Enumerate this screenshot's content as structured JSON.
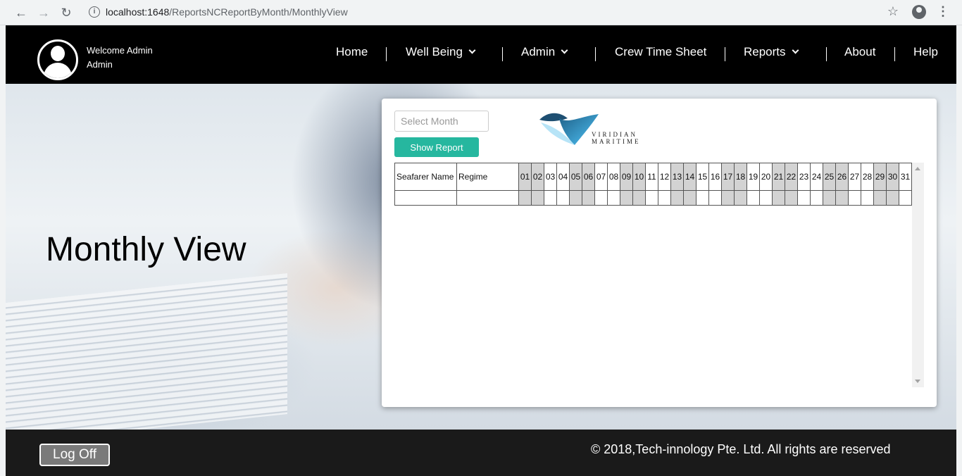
{
  "browser": {
    "url_host": "localhost:1648",
    "url_path": "/ReportsNCReportByMonth/MonthlyView",
    "star_icon": "star-icon",
    "account_icon": "account-icon"
  },
  "header": {
    "welcome_line1": "Welcome Admin",
    "welcome_line2": "Admin",
    "nav": {
      "home": "Home",
      "well_being": "Well Being",
      "admin": "Admin",
      "crew_time_sheet": "Crew Time Sheet",
      "reports": "Reports",
      "about": "About",
      "help": "Help"
    }
  },
  "hero": {
    "title": "Monthly View"
  },
  "panel": {
    "month_placeholder": "Select Month",
    "show_report_label": "Show Report",
    "logo_line1": "VIRIDIAN",
    "logo_line2": "MARITIME",
    "table": {
      "col_name": "Seafarer Name",
      "col_regime": "Regime",
      "days": [
        "01",
        "02",
        "03",
        "04",
        "05",
        "06",
        "07",
        "08",
        "09",
        "10",
        "11",
        "12",
        "13",
        "14",
        "15",
        "16",
        "17",
        "18",
        "19",
        "20",
        "21",
        "22",
        "23",
        "24",
        "25",
        "26",
        "27",
        "28",
        "29",
        "30",
        "31"
      ],
      "shaded_days": [
        "01",
        "02",
        "05",
        "06",
        "09",
        "10",
        "13",
        "14",
        "17",
        "18",
        "21",
        "22",
        "25",
        "26",
        "29",
        "30"
      ]
    }
  },
  "footer": {
    "logoff_label": "Log Off",
    "copyright": "© 2018,Tech-innology Pte. Ltd. All rights are reserved"
  },
  "colors": {
    "accent_button": "#26b79f",
    "header_bg": "#000000",
    "footer_bg": "#1a1a1a",
    "shaded_cell": "#d3d3d3"
  }
}
